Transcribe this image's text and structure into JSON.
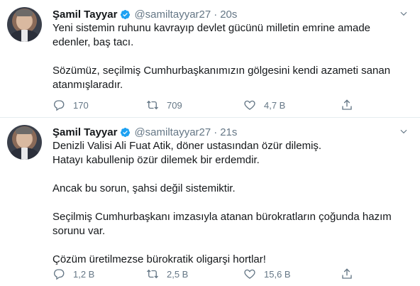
{
  "tweets": [
    {
      "name": "Şamil Tayyar",
      "handle": "@samiltayyar27",
      "separator": "·",
      "time": "20s",
      "paragraphs": [
        "Yeni sistemin ruhunu kavrayıp devlet gücünü milletin emrine amade edenler, baş tacı.",
        "Sözümüz, seçilmiş Cumhurbaşkanımızın gölgesini kendi azameti sanan atanmışlaradır."
      ],
      "replies": "170",
      "retweets": "709",
      "likes": "4,7 B"
    },
    {
      "name": "Şamil Tayyar",
      "handle": "@samiltayyar27",
      "separator": "·",
      "time": "21s",
      "paragraphs": [
        "Denizli Valisi Ali Fuat Atik, döner ustasından özür dilemiş.\nHatayı kabullenip özür dilemek bir erdemdir.",
        "Ancak bu sorun, şahsi değil sistemiktir.",
        "Seçilmiş Cumhurbaşkanı imzasıyla atanan bürokratların çoğunda hazım sorunu var.",
        "Çözüm üretilmezse bürokratik oligarşi hortlar!"
      ],
      "replies": "1,2 B",
      "retweets": "2,5 B",
      "likes": "15,6 B"
    }
  ],
  "icons": {
    "verified": "verified-badge-icon",
    "more": "chevron-down-icon",
    "reply": "reply-icon",
    "retweet": "retweet-icon",
    "like": "heart-icon",
    "share": "share-icon"
  },
  "colors": {
    "verified": "#1da1f2",
    "secondary_text": "#657786",
    "primary_text": "#14171a",
    "divider": "#e6ecf0"
  }
}
